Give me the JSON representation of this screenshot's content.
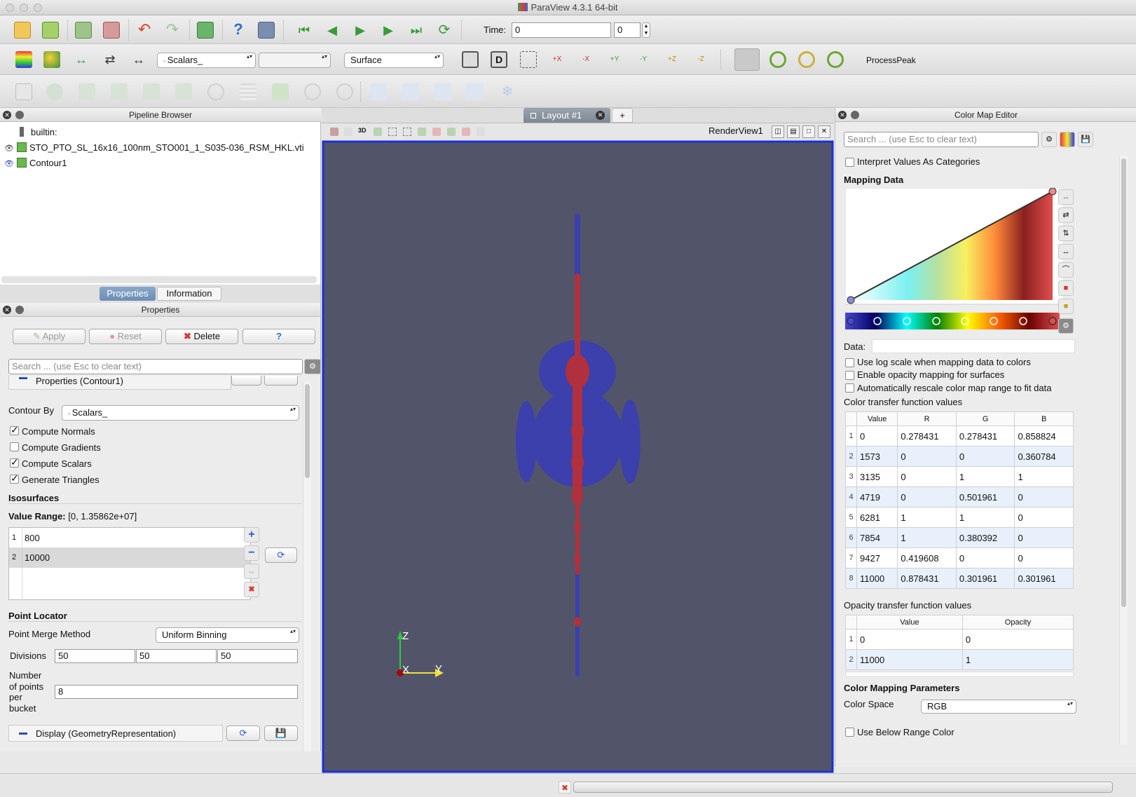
{
  "window": {
    "title": "ParaView 4.3.1 64-bit"
  },
  "toolbar": {
    "time_label": "Time:",
    "time_value": "0",
    "time_step": "0",
    "scalars_combo": "Scalars_",
    "component_combo": "",
    "representation_combo": "Surface",
    "macro_label": "ProcessPeak",
    "axis_labels": [
      "+X",
      "-X",
      "+Y",
      "-Y",
      "+Z",
      "-Z"
    ],
    "view_3d_label": "3D"
  },
  "pipeline": {
    "title": "Pipeline Browser",
    "items": [
      {
        "label": "builtin:"
      },
      {
        "label": "STO_PTO_SL_16x16_100nm_STO001_1_S035-036_RSM_HKL.vti"
      },
      {
        "label": "Contour1"
      }
    ]
  },
  "tabs": {
    "properties": "Properties",
    "information": "Information"
  },
  "properties": {
    "title": "Properties",
    "apply": "Apply",
    "reset": "Reset",
    "delete": "Delete",
    "help": "?",
    "search_placeholder": "Search ... (use Esc to clear text)",
    "section_contour": "Properties (Contour1)",
    "contour_by_label": "Contour By",
    "contour_by_value": "Scalars_",
    "compute_normals": "Compute Normals",
    "compute_gradients": "Compute Gradients",
    "compute_scalars": "Compute Scalars",
    "generate_triangles": "Generate Triangles",
    "isosurfaces_label": "Isosurfaces",
    "value_range_label": "Value Range:",
    "value_range": "[0, 1.35862e+07]",
    "isovalues": [
      {
        "idx": "1",
        "value": "800"
      },
      {
        "idx": "2",
        "value": "10000"
      }
    ],
    "point_locator": "Point Locator",
    "merge_method_label": "Point Merge Method",
    "merge_method_value": "Uniform Binning",
    "divisions_label": "Divisions",
    "divisions": [
      "50",
      "50",
      "50"
    ],
    "points_per_bucket_label_1": "Number",
    "points_per_bucket_label_2": "of points",
    "points_per_bucket_label_3": "per",
    "points_per_bucket_label_4": "bucket",
    "points_per_bucket": "8",
    "section_display": "Display (GeometryRepresentation)"
  },
  "layout": {
    "tab_label": "Layout #1",
    "add_tab": "+",
    "view_name": "RenderView1",
    "axes": {
      "z": "Z",
      "x": "X",
      "y": "Y"
    }
  },
  "colormap": {
    "title": "Color Map Editor",
    "search_placeholder": "Search ... (use Esc to clear text)",
    "interpret_categories": "Interpret Values As Categories",
    "mapping_data": "Mapping Data",
    "data_label": "Data:",
    "log_scale": "Use log scale when mapping data to colors",
    "opacity_mapping": "Enable opacity mapping for surfaces",
    "auto_rescale": "Automatically rescale color map range to fit data",
    "ctf_title": "Color transfer function values",
    "ctf_headers": [
      "Value",
      "R",
      "G",
      "B"
    ],
    "ctf_rows": [
      [
        "1",
        "0",
        "0.278431",
        "0.278431",
        "0.858824"
      ],
      [
        "2",
        "1573",
        "0",
        "0",
        "0.360784"
      ],
      [
        "3",
        "3135",
        "0",
        "1",
        "1"
      ],
      [
        "4",
        "4719",
        "0",
        "0.501961",
        "0"
      ],
      [
        "5",
        "6281",
        "1",
        "1",
        "0"
      ],
      [
        "6",
        "7854",
        "1",
        "0.380392",
        "0"
      ],
      [
        "7",
        "9427",
        "0.419608",
        "0",
        "0"
      ],
      [
        "8",
        "11000",
        "0.878431",
        "0.301961",
        "0.301961"
      ]
    ],
    "otf_title": "Opacity transfer function values",
    "otf_headers": [
      "Value",
      "Opacity"
    ],
    "otf_rows": [
      [
        "1",
        "0",
        "0"
      ],
      [
        "2",
        "11000",
        "1"
      ]
    ],
    "mapping_params": "Color Mapping Parameters",
    "color_space_label": "Color Space",
    "color_space_value": "RGB",
    "below_range": "Use Below Range Color"
  },
  "colors": {
    "render_bg": "#525569",
    "isosurface_outer": "#3a3fb0",
    "isosurface_inner": "#b0303d",
    "selection_border": "#1b2fd6"
  }
}
